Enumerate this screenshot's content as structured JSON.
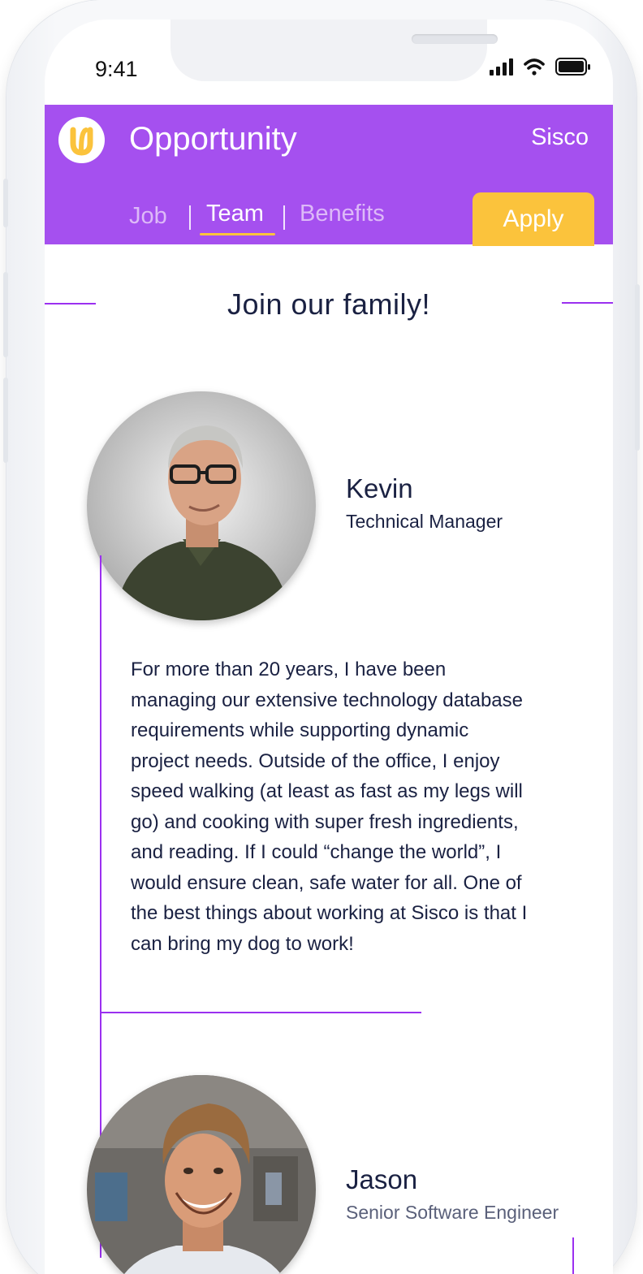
{
  "status_bar": {
    "time": "9:41"
  },
  "header": {
    "title": "Opportunity",
    "company": "Sisco",
    "tabs": [
      {
        "label": "Job",
        "active": false
      },
      {
        "label": "Team",
        "active": true
      },
      {
        "label": "Benefits",
        "active": false
      }
    ],
    "apply_label": "Apply"
  },
  "section": {
    "title": "Join our family!"
  },
  "members": [
    {
      "name": "Kevin",
      "role": "Technical Manager",
      "bio": "For more than 20 years, I have been managing our extensive technology database requirements while supporting dynamic project needs. Outside of the office, I enjoy speed walking (at least as fast as my legs will go) and cooking with super fresh ingredients, and reading. If I could “change the world”, I would ensure clean, safe water for all. One of the best things about working at Sisco is that I can bring my dog to work!"
    },
    {
      "name": "Jason",
      "role": "Senior Software Engineer"
    }
  ],
  "colors": {
    "brand_purple": "#a550ef",
    "accent_yellow": "#fbc33c",
    "line_purple": "#9b30f0",
    "text_dark": "#1a2142"
  },
  "icons": [
    "app-logo-icon",
    "signal-icon",
    "wifi-icon",
    "battery-icon"
  ]
}
